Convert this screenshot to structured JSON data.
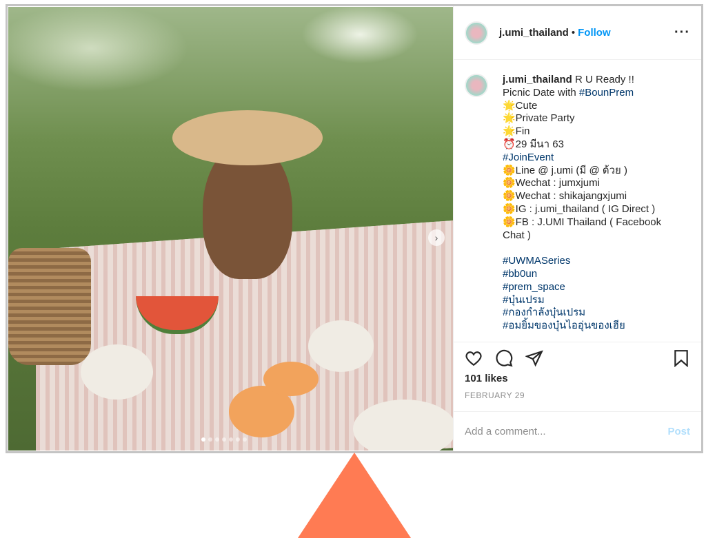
{
  "post": {
    "username": "j.umi_thailand",
    "follow_label": "Follow",
    "separator": "•",
    "more_icon": "ellipsis-icon",
    "caption_lines": [
      {
        "text": "R U Ready !!",
        "tag": false
      },
      {
        "text": "Picnic Date with ",
        "tag": false
      },
      {
        "text": "#BounPrem",
        "tag": true
      },
      {
        "text": "🌟Cute",
        "tag": false
      },
      {
        "text": "🌟Private Party",
        "tag": false
      },
      {
        "text": "🌟Fin",
        "tag": false
      },
      {
        "text": "⏰29 มีนา 63",
        "tag": false
      },
      {
        "text": "#JoinEvent",
        "tag": true
      },
      {
        "text": "🌼Line @ j.umi (มี @ ด้วย )",
        "tag": false
      },
      {
        "text": "🌼Wechat : jumxjumi",
        "tag": false
      },
      {
        "text": "🌼Wechat : shikajangxjumi",
        "tag": false
      },
      {
        "text": "🌼IG : j.umi_thailand ( IG Direct )",
        "tag": false
      },
      {
        "text": "🌼FB : J.UMI Thailand ( Facebook Chat )",
        "tag": false
      },
      {
        "text": "#UWMASeries",
        "tag": true
      },
      {
        "text": "#bb0un",
        "tag": true
      },
      {
        "text": "#prem_space",
        "tag": true
      },
      {
        "text": "#บุ๋นเปรม",
        "tag": true
      },
      {
        "text": "#กองกำลังบุ๋นเปรม",
        "tag": true
      },
      {
        "text": "#อมยิ้มของบุ๋นไออุ่นของเฮีย",
        "tag": true
      }
    ],
    "likes": "101 likes",
    "date": "FEBRUARY 29",
    "comment_placeholder": "Add a comment...",
    "post_label": "Post",
    "carousel": {
      "current": 1,
      "total": 7
    },
    "colors": {
      "link": "#0095f6",
      "hashtag": "#00376b",
      "post_disabled": "#b2dffc",
      "arrow": "#ff7b53"
    }
  }
}
